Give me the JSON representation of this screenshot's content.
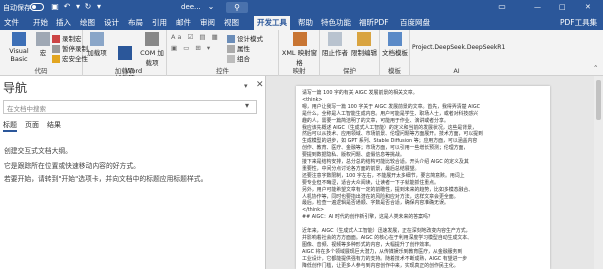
{
  "titlebar": {
    "autosave": "自动保存",
    "doc": "dee...",
    "win_min": "—",
    "win_max": "□",
    "win_close": "✕"
  },
  "tabs": [
    "文件",
    "开始",
    "插入",
    "绘图",
    "设计",
    "布局",
    "引用",
    "邮件",
    "审阅",
    "视图",
    "开发工具",
    "帮助",
    "特色功能",
    "福昕PDF",
    "百度网盘",
    "PDF工具集"
  ],
  "active_tab": "开发工具",
  "ribbon": {
    "code": {
      "vb": "Visual Basic",
      "macro": "宏",
      "record": "录制宏",
      "pause": "暂停录制",
      "security": "宏安全性",
      "label": "代码"
    },
    "addins": {
      "addin": "加载项",
      "word_addin": "Word\n加载项",
      "com": "COM 加载项",
      "label": "加载项"
    },
    "controls": {
      "design": "设计模式",
      "props": "属性",
      "group": "组合",
      "label": "控件"
    },
    "mapping": {
      "xml": "XML 映射窗格",
      "label": "映射"
    },
    "protect": {
      "block": "阻止作者",
      "restrict": "限制编辑",
      "label": "保护"
    },
    "templates": {
      "doc_tpl": "文档模板",
      "label": "模板"
    },
    "ai": {
      "project": "Project.DeepSeek.DeepSeekR1",
      "label": "AI"
    }
  },
  "nav": {
    "title": "导航",
    "search_placeholder": "在文档中搜索",
    "tabs": [
      "标题",
      "页面",
      "结果"
    ],
    "lines": [
      "创建交互式文档大纲。",
      "它是跟踪所在位置或快速移动内容的好方式。",
      "若要开始，请转到\"开始\"选项卡，并向文档中的标题应用标题样式。"
    ]
  },
  "document": {
    "lines": [
      "请写一篇 100 字的有关 AIGC 发展前景的相关文章。",
      "<think>",
      "嗯，用户让我写一篇 100 字关于 AIGC 发展前景的文章。首先，我得弄清楚 AIGC",
      "是什么，全称是人工智能生成内容。用户可能是学生、职场人士，或者对科技感兴",
      "趣的人，需要一篇简洁明了的文章，可能用于作业、演讲或者分享。",
      "我应该先概述 AIGC（生成式人工智能）的定义和当前的发展状况，这些是背景，",
      "然后可以从技术、应用领域、市场前景、伦理问题等方面展开。技术方面，可以提到",
      "生成模型的进步，如 GPT 系列、Stable Diffusion 等；应用方面，可以涵盖内容",
      "创作、教育、医疗、金融等；市场方面，可以引用一些增长预测；伦理方面，",
      "要提到数据隐私、版权问题、虚假信息等挑战。",
      "接下来是结构安排，总分总的结构可能比较合适。开头介绍 AIGC 的定义及其",
      "重要性，中间分点讨论各方面的前景，最后总结展望。",
      "还要注意字数限制，100 字左右，不能展开太多细节，要言简意赅。用词上",
      "要专业但不晦涩，适合大众阅读，让读者一下子就能抓住重点。",
      "另外，用户可能希望文章有一定的前瞻性，提到未来的趋势，比如多模态融合、",
      "人机协作等，同时也要指出潜在的风险和应对方法，这样文章会更全面。",
      "最后，检查一遍逻辑是否通顺、字数是否合适，确保内容准确无误。",
      "</think>",
      "## AIGC：AI 时代的创作新引擎，这是人类未来的答案吗？",
      "",
      "近年来，AIGC（生成式人工智能）迅速发展，正在深刻地改变内容生产方式，",
      "并影响着社会的方方面面。AIGC 的核心在于利用深度学习模型自动生成文本、",
      "图像、音频、视频等多种形式的内容，大幅提升了创作效率。",
      "AIGC 将在多个领域展现巨大潜力，从传媒娱乐到教育医疗，从金融服务到",
      "工业设计，它都能提供强有力的支持。随着技术不断成熟，AIGC 有望进一步",
      "降低创作门槛，让更多人参与到内容创作中来，实现真正的创作民主化。"
    ]
  }
}
